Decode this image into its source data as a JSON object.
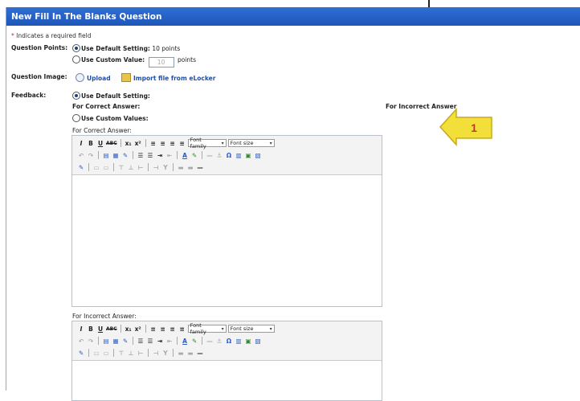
{
  "title": "New Fill In The Blanks Question",
  "required_note": {
    "star": "*",
    "text": "Indicates a required field"
  },
  "question_points": {
    "label": "Question Points:",
    "default_option": "Use Default Setting:",
    "default_value": "10 points",
    "custom_option": "Use Custom Value:",
    "custom_input": "10",
    "custom_unit": "points"
  },
  "question_image": {
    "label": "Question Image:",
    "upload": "Upload",
    "import": "Import file from eLocker"
  },
  "feedback": {
    "label": "Feedback:",
    "default_option": "Use Default Setting:",
    "for_correct": "For Correct Answer:",
    "for_incorrect": "For Incorrect Answer",
    "custom_option": "Use Custom Values:"
  },
  "editors": [
    {
      "caption": "For Correct Answer:"
    },
    {
      "caption": "For Incorrect Answer:"
    }
  ],
  "toolbar": {
    "font_family": "Font family",
    "font_size": "Font size"
  },
  "callout": {
    "number": "1",
    "color": "#f3df3a"
  },
  "colors": {
    "titlebar": "#2463c9"
  }
}
